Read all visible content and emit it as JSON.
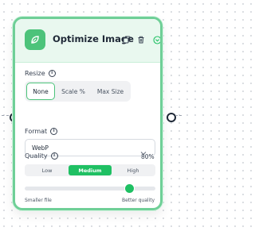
{
  "node": {
    "title": "Optimize Image",
    "header_icons": [
      "leaf-icon",
      "copy-icon",
      "trash-icon",
      "collapse-icon"
    ]
  },
  "resize": {
    "label": "Resize",
    "options": [
      "None",
      "Scale %",
      "Max Size"
    ],
    "selected": "None"
  },
  "format": {
    "label": "Format",
    "value": "WebP"
  },
  "quality": {
    "label": "Quality",
    "value_text": "80%",
    "value": 80,
    "options": [
      "Low",
      "Medium",
      "High"
    ],
    "selected": "Medium",
    "min_label": "Smaller file",
    "max_label": "Better quality"
  },
  "colors": {
    "accent": "#1fc063",
    "border": "#6fcf97",
    "header_bg": "#e9f8ef"
  }
}
